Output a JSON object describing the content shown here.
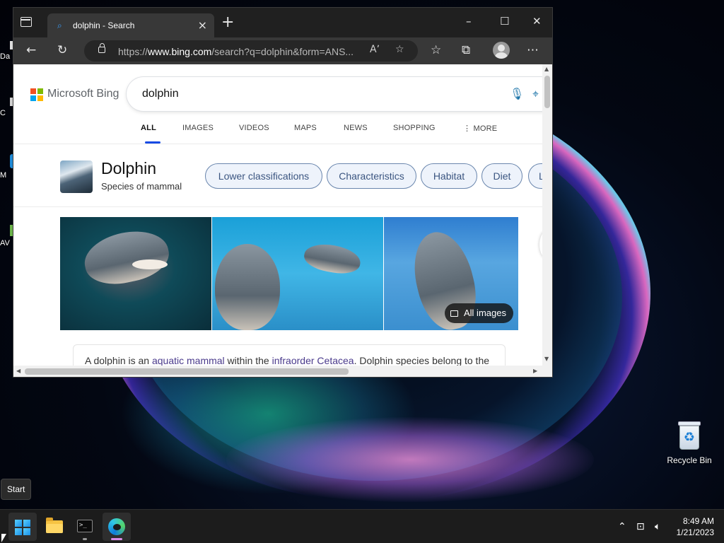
{
  "desktop": {
    "left_icons": [
      {
        "label": "Da"
      },
      {
        "label": "C"
      },
      {
        "label": "M"
      },
      {
        "label": "AV"
      }
    ],
    "recycle_bin": {
      "label": "Recycle Bin",
      "icon": "recycle-bin-icon"
    },
    "start_tooltip": "Start"
  },
  "browser": {
    "tab": {
      "title": "dolphin - Search",
      "favicon": "search-icon"
    },
    "window_controls": {
      "minimize": "minimize-icon",
      "maximize": "maximize-icon",
      "close": "close-icon"
    },
    "address_bar": {
      "url_prefix": "https://",
      "url_domain": "www.bing.com",
      "url_rest": "/search?q=dolphin&form=ANS...",
      "icons": [
        "lock-icon",
        "read-aloud-icon",
        "add-favorite-icon"
      ]
    },
    "toolbar_icons": [
      "back-icon",
      "refresh-icon",
      "favorites-icon",
      "collections-icon",
      "profile-icon",
      "more-icon"
    ]
  },
  "bing": {
    "brand": "Microsoft Bing",
    "query": "dolphin",
    "nav_tabs": [
      {
        "label": "ALL",
        "active": true
      },
      {
        "label": "IMAGES"
      },
      {
        "label": "VIDEOS"
      },
      {
        "label": "MAPS"
      },
      {
        "label": "NEWS"
      },
      {
        "label": "SHOPPING"
      },
      {
        "label": "⋮ MORE"
      }
    ],
    "entity": {
      "title": "Dolphin",
      "subtitle": "Species of mammal",
      "chips": [
        "Lower classifications",
        "Characteristics",
        "Habitat",
        "Diet",
        "L"
      ]
    },
    "all_images_label": "All images",
    "description": {
      "part1": "A dolphin is an ",
      "link1": "aquatic mammal",
      "part2": " within the ",
      "link2": "infraorder Cetacea",
      "part3": ". Dolphin species belong to the"
    }
  },
  "taskbar": {
    "apps": [
      "windows-start-icon",
      "file-explorer-icon",
      "terminal-icon",
      "edge-browser-icon"
    ],
    "tray_icons": [
      "chevron-up-icon",
      "network-icon",
      "volume-icon"
    ],
    "time": "8:49 AM",
    "date": "1/21/2023"
  }
}
